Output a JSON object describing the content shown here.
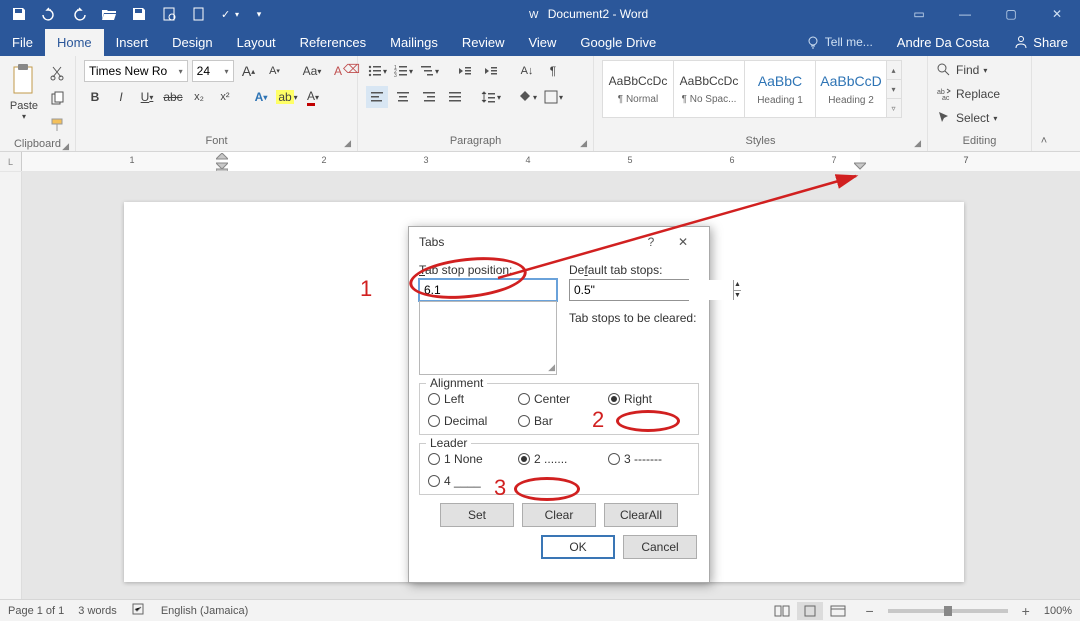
{
  "app": {
    "title": "Document2 - Word"
  },
  "qat": [
    "save",
    "undo",
    "redo",
    "open-folder",
    "save-as",
    "print-preview",
    "new-doc",
    "spelling",
    "dropdown"
  ],
  "sys": {
    "help": "?",
    "ribbon_opts": "▭",
    "min": "—",
    "max": "▢",
    "close": "✕"
  },
  "tabs": {
    "items": [
      "File",
      "Home",
      "Insert",
      "Design",
      "Layout",
      "References",
      "Mailings",
      "Review",
      "View",
      "Google Drive"
    ],
    "active": 1,
    "tellme": "Tell me...",
    "user": "Andre Da Costa",
    "share": "Share"
  },
  "ribbon": {
    "clipboard": {
      "label": "Clipboard",
      "paste": "Paste"
    },
    "font": {
      "label": "Font",
      "name": "Times New Ro",
      "size": "24",
      "grow": "A",
      "shrink": "A",
      "case": "Aa",
      "clear": "A",
      "bold": "B",
      "italic": "I",
      "underline": "U",
      "strike": "abc",
      "sub": "x₂",
      "sup": "x²",
      "effects": "A",
      "highlight": "ab",
      "color": "A"
    },
    "paragraph": {
      "label": "Paragraph"
    },
    "styles": {
      "label": "Styles",
      "items": [
        {
          "sample": "AaBbCcDc",
          "name": "¶ Normal"
        },
        {
          "sample": "AaBbCcDc",
          "name": "¶ No Spac..."
        },
        {
          "sample": "AaBbC",
          "name": "Heading 1",
          "blue": true
        },
        {
          "sample": "AaBbCcD",
          "name": "Heading 2",
          "blue": true
        }
      ]
    },
    "editing": {
      "label": "Editing",
      "find": "Find",
      "replace": "Replace",
      "select": "Select"
    }
  },
  "ruler": {
    "numbers": [
      1,
      2,
      3,
      4,
      5,
      6,
      7
    ]
  },
  "dialog": {
    "title": "Tabs",
    "tabstop_label": "Tab stop position:",
    "tabstop_value": "6.1",
    "default_label": "Default tab stops:",
    "default_value": "0.5\"",
    "clear_note": "Tab stops to be cleared:",
    "alignment": {
      "title": "Alignment",
      "left": "Left",
      "center": "Center",
      "right": "Right",
      "decimal": "Decimal",
      "bar": "Bar",
      "selected": "right"
    },
    "leader": {
      "title": "Leader",
      "opt1": "1 None",
      "opt2": "2 .......",
      "opt3": "3 -------",
      "opt4": "4 ____",
      "selected": "2"
    },
    "buttons": {
      "set": "Set",
      "clear": "Clear",
      "clearall": "Clear All",
      "ok": "OK",
      "cancel": "Cancel"
    }
  },
  "annotations": {
    "n1": "1",
    "n2": "2",
    "n3": "3"
  },
  "status": {
    "page": "Page 1 of 1",
    "words": "3 words",
    "lang": "English (Jamaica)",
    "zoom": "100%"
  }
}
